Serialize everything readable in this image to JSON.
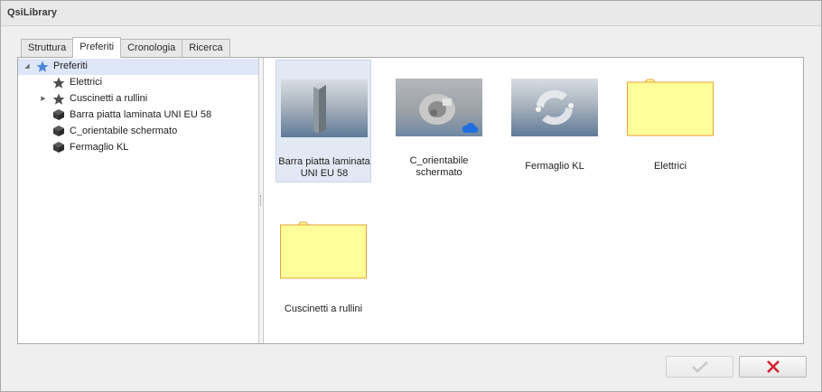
{
  "window": {
    "title": "QsiLibrary"
  },
  "tabs": [
    {
      "label": "Struttura",
      "active": false
    },
    {
      "label": "Preferiti",
      "active": true
    },
    {
      "label": "Cronologia",
      "active": false
    },
    {
      "label": "Ricerca",
      "active": false
    }
  ],
  "tree": {
    "root": {
      "label": "Preferiti",
      "icon": "star-icon",
      "expanded": true,
      "selected": true
    },
    "items": [
      {
        "label": "Elettrici",
        "icon": "star-icon",
        "expandable": false
      },
      {
        "label": "Cuscinetti a rullini",
        "icon": "star-icon",
        "expandable": true
      },
      {
        "label": "Barra piatta laminata UNI EU 58",
        "icon": "cube-icon",
        "expandable": false
      },
      {
        "label": "C_orientabile schermato",
        "icon": "cube-icon",
        "expandable": false
      },
      {
        "label": "Fermaglio KL",
        "icon": "cube-icon",
        "expandable": false
      }
    ]
  },
  "content": {
    "items": [
      {
        "label": "Barra piatta laminata UNI EU 58",
        "kind": "model",
        "selected": true
      },
      {
        "label": "C_orientabile schermato",
        "kind": "model",
        "cloud": true
      },
      {
        "label": "Fermaglio KL",
        "kind": "model"
      },
      {
        "label": "Elettrici",
        "kind": "folder"
      },
      {
        "label": "Cuscinetti a rullini",
        "kind": "folder"
      }
    ]
  },
  "buttons": {
    "ok": {
      "icon": "check-icon",
      "enabled": false
    },
    "cancel": {
      "icon": "close-icon",
      "enabled": true
    }
  },
  "colors": {
    "accent": "#4a86d8",
    "folder": "#ffff99",
    "folder_border": "#e8a23a",
    "cancel_red": "#d3242c"
  }
}
